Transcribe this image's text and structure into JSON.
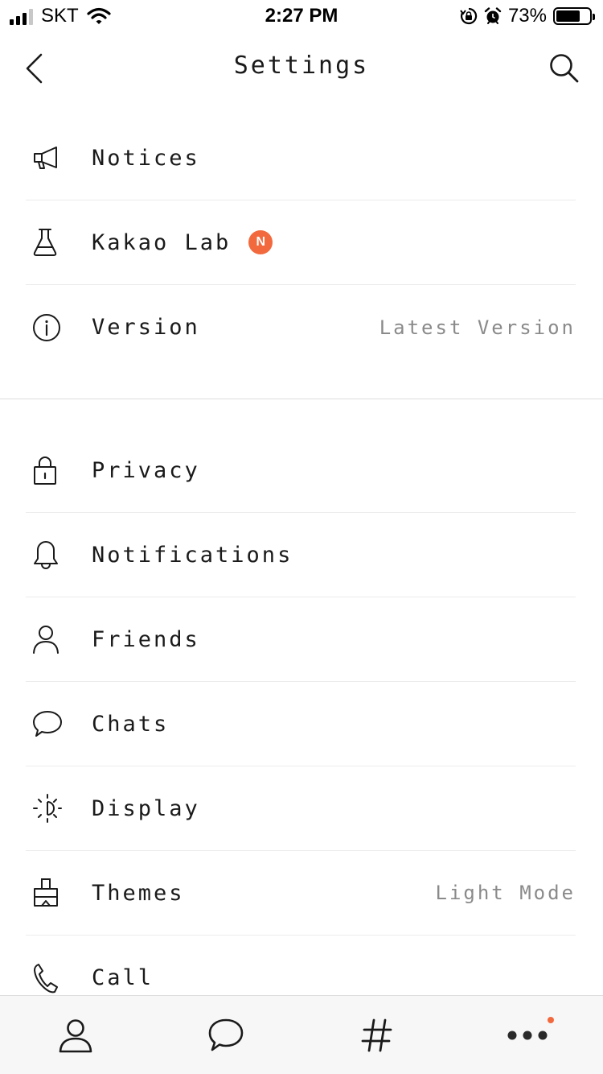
{
  "status_bar": {
    "carrier": "SKT",
    "time": "2:27 PM",
    "battery_percent": "73%",
    "battery_level": 0.73,
    "icons": [
      "signal-icon",
      "wifi-icon",
      "orientation-lock-icon",
      "alarm-icon",
      "battery-icon"
    ]
  },
  "header": {
    "title": "Settings",
    "back_icon": "chevron-left-icon",
    "search_icon": "search-icon"
  },
  "section_1": {
    "items": [
      {
        "label": "Notices",
        "icon": "megaphone-icon"
      },
      {
        "label": "Kakao Lab",
        "icon": "flask-icon",
        "badge": "N"
      },
      {
        "label": "Version",
        "icon": "info-icon",
        "value": "Latest Version"
      }
    ]
  },
  "section_2": {
    "items": [
      {
        "label": "Privacy",
        "icon": "lock-icon"
      },
      {
        "label": "Notifications",
        "icon": "bell-icon"
      },
      {
        "label": "Friends",
        "icon": "person-icon"
      },
      {
        "label": "Chats",
        "icon": "chat-bubble-icon"
      },
      {
        "label": "Display",
        "icon": "sun-icon"
      },
      {
        "label": "Themes",
        "icon": "paint-brush-icon",
        "value": "Light Mode"
      },
      {
        "label": "Call",
        "icon": "phone-icon"
      }
    ]
  },
  "tab_bar": {
    "tabs": [
      {
        "name": "friends",
        "icon": "person-icon"
      },
      {
        "name": "chats",
        "icon": "chat-bubble-icon"
      },
      {
        "name": "view",
        "icon": "hashtag-icon"
      },
      {
        "name": "more",
        "icon": "more-dots-icon",
        "has_new_dot": true
      }
    ],
    "accent_color": "#f2693d"
  }
}
